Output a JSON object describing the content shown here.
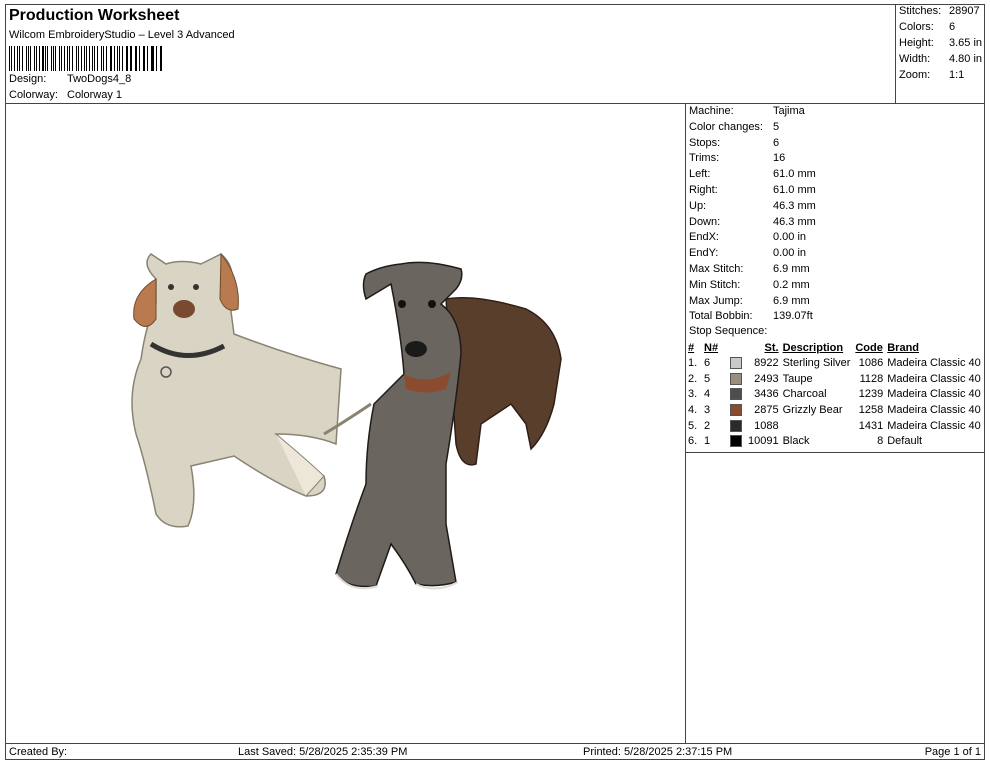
{
  "header": {
    "title": "Production Worksheet",
    "subtitle": "Wilcom EmbroideryStudio – Level 3 Advanced",
    "design_label": "Design:",
    "design_value": "TwoDogs4_8",
    "colorway_label": "Colorway:",
    "colorway_value": "Colorway 1"
  },
  "stats": [
    {
      "label": "Stitches:",
      "value": "28907"
    },
    {
      "label": "Colors:",
      "value": "6"
    },
    {
      "label": "Height:",
      "value": "3.65 in"
    },
    {
      "label": "Width:",
      "value": "4.80 in"
    },
    {
      "label": "Zoom:",
      "value": "1:1"
    }
  ],
  "machine": [
    {
      "label": "Machine:",
      "value": "Tajima"
    },
    {
      "label": "Color changes:",
      "value": "5"
    },
    {
      "label": "Stops:",
      "value": "6"
    },
    {
      "label": "Trims:",
      "value": "16"
    },
    {
      "label": "Left:",
      "value": "61.0 mm"
    },
    {
      "label": "Right:",
      "value": "61.0 mm"
    },
    {
      "label": "Up:",
      "value": "46.3 mm"
    },
    {
      "label": "Down:",
      "value": "46.3 mm"
    },
    {
      "label": "EndX:",
      "value": "0.00 in"
    },
    {
      "label": "EndY:",
      "value": "0.00 in"
    },
    {
      "label": "Max Stitch:",
      "value": "6.9 mm"
    },
    {
      "label": "Min Stitch:",
      "value": "0.2 mm"
    },
    {
      "label": "Max Jump:",
      "value": "6.9 mm"
    },
    {
      "label": "Total Bobbin:",
      "value": "139.07ft"
    }
  ],
  "stop_sequence": {
    "label": "Stop Sequence:",
    "headers": {
      "num": "#",
      "n": "N#",
      "st": "St.",
      "desc": "Description",
      "code": "Code",
      "brand": "Brand"
    },
    "rows": [
      {
        "num": "1.",
        "n": "6",
        "color": "#c9c9c6",
        "st": "8922",
        "desc": "Sterling Silver",
        "code": "1086",
        "brand": "Madeira Classic 40"
      },
      {
        "num": "2.",
        "n": "5",
        "color": "#9a8e7c",
        "st": "2493",
        "desc": "Taupe",
        "code": "1128",
        "brand": "Madeira Classic 40"
      },
      {
        "num": "3.",
        "n": "4",
        "color": "#4e4e4e",
        "st": "3436",
        "desc": "Charcoal",
        "code": "1239",
        "brand": "Madeira Classic 40"
      },
      {
        "num": "4.",
        "n": "3",
        "color": "#8a4b2e",
        "st": "2875",
        "desc": "Grizzly Bear",
        "code": "1258",
        "brand": "Madeira Classic 40"
      },
      {
        "num": "5.",
        "n": "2",
        "color": "#2a2a2a",
        "st": "1088",
        "desc": "",
        "code": "1431",
        "brand": "Madeira Classic 40"
      },
      {
        "num": "6.",
        "n": "1",
        "color": "#000000",
        "st": "10091",
        "desc": "Black",
        "code": "8",
        "brand": "Default"
      }
    ]
  },
  "footer": {
    "created": "Created By:",
    "saved": "Last Saved: 5/28/2025 2:35:39 PM",
    "printed": "Printed: 5/28/2025 2:37:15 PM",
    "page": "Page 1 of 1"
  },
  "design_preview": {
    "left_dog_color": "#d9d4c4",
    "right_dog_color": "#6b6560",
    "accent_color": "#8a4b2e"
  }
}
